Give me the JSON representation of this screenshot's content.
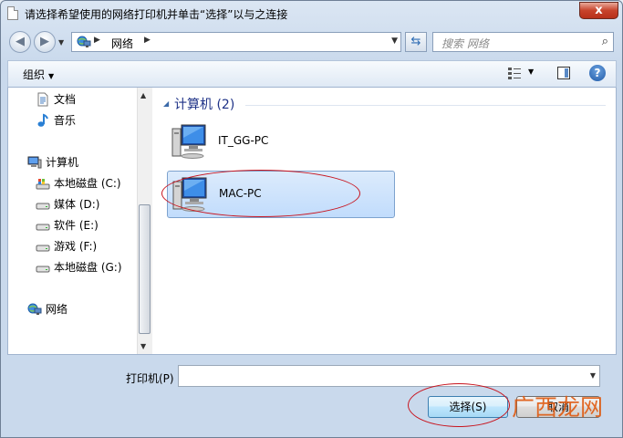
{
  "window": {
    "title": "请选择希望使用的网络打印机并单击“选择”以与之连接",
    "close_glyph": "x"
  },
  "nav": {
    "back_glyph": "◀",
    "forward_glyph": "▶",
    "address_separator": "▶",
    "address_location": "网络",
    "address_icon": "network-icon",
    "search_placeholder": "搜索 网络"
  },
  "toolbar": {
    "organize_label": "组织",
    "help_glyph": "?"
  },
  "sidebar": {
    "items": [
      {
        "label": "文档",
        "icon": "document-icon"
      },
      {
        "label": "音乐",
        "icon": "music-icon"
      },
      {
        "label": "计算机",
        "icon": "computer-icon"
      },
      {
        "label": "本地磁盘 (C:)",
        "icon": "system-drive-icon"
      },
      {
        "label": "媒体 (D:)",
        "icon": "drive-icon"
      },
      {
        "label": "软件 (E:)",
        "icon": "drive-icon"
      },
      {
        "label": "游戏 (F:)",
        "icon": "drive-icon"
      },
      {
        "label": "本地磁盘 (G:)",
        "icon": "drive-icon"
      },
      {
        "label": "网络",
        "icon": "network-icon"
      }
    ]
  },
  "main": {
    "group_title": "计算机 (2)",
    "computers": [
      {
        "name": "IT_GG-PC",
        "selected": false
      },
      {
        "name": "MAC-PC",
        "selected": true
      }
    ]
  },
  "footer": {
    "printer_label": "打印机(P)",
    "printer_value": "",
    "select_button": "选择(S)",
    "cancel_button": "取消"
  },
  "watermark": "广西龙网",
  "colors": {
    "annotation_ellipse": "#c8141e",
    "selection_fill": "#c1dcfc",
    "group_title": "#1e3287",
    "watermark": "#e05a10"
  }
}
